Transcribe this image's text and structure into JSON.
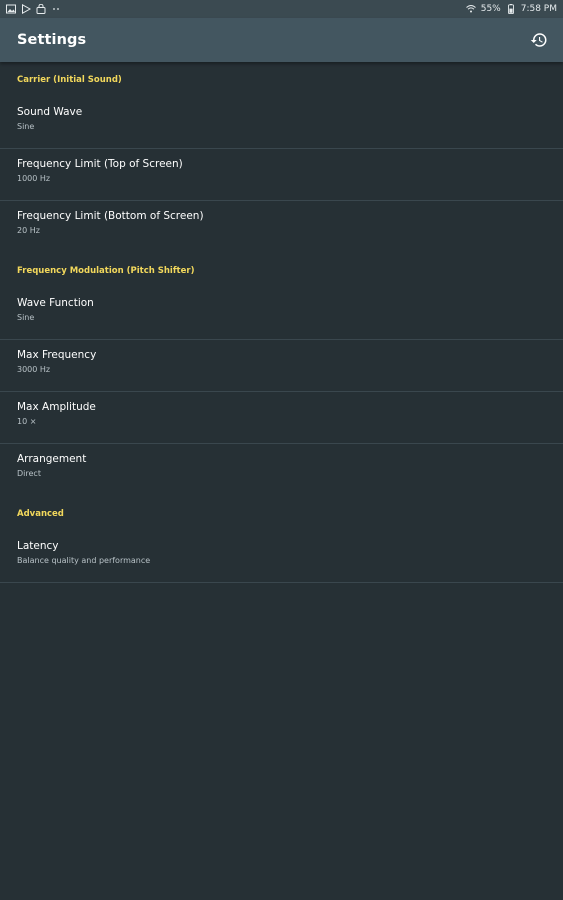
{
  "status_bar": {
    "left_icons": [
      "image-icon",
      "play-store-icon",
      "lock-app-icon",
      "more-dots-icon"
    ],
    "battery": "55%",
    "time": "7:58 PM"
  },
  "app_bar": {
    "title": "Settings",
    "reset_icon": "restore-icon"
  },
  "sections": {
    "carrier": {
      "header": "Carrier (Initial Sound)",
      "sound_wave": {
        "title": "Sound Wave",
        "summary": "Sine"
      },
      "freq_top": {
        "title": "Frequency Limit (Top of Screen)",
        "summary": "1000 Hz"
      },
      "freq_bottom": {
        "title": "Frequency Limit (Bottom of Screen)",
        "summary": "20 Hz"
      }
    },
    "fm": {
      "header": "Frequency Modulation (Pitch Shifter)",
      "wave_function": {
        "title": "Wave Function",
        "summary": "Sine"
      },
      "max_frequency": {
        "title": "Max Frequency",
        "summary": "3000 Hz"
      },
      "max_amplitude": {
        "title": "Max Amplitude",
        "summary": "10 ×"
      },
      "arrangement": {
        "title": "Arrangement",
        "summary": "Direct"
      }
    },
    "advanced": {
      "header": "Advanced",
      "latency": {
        "title": "Latency",
        "summary": "Balance quality and performance"
      }
    }
  },
  "colors": {
    "background": "#263035",
    "app_bar": "#435660",
    "status_bar": "#3b4a51",
    "category_accent": "#f2d85c",
    "divider": "#3a474e"
  }
}
